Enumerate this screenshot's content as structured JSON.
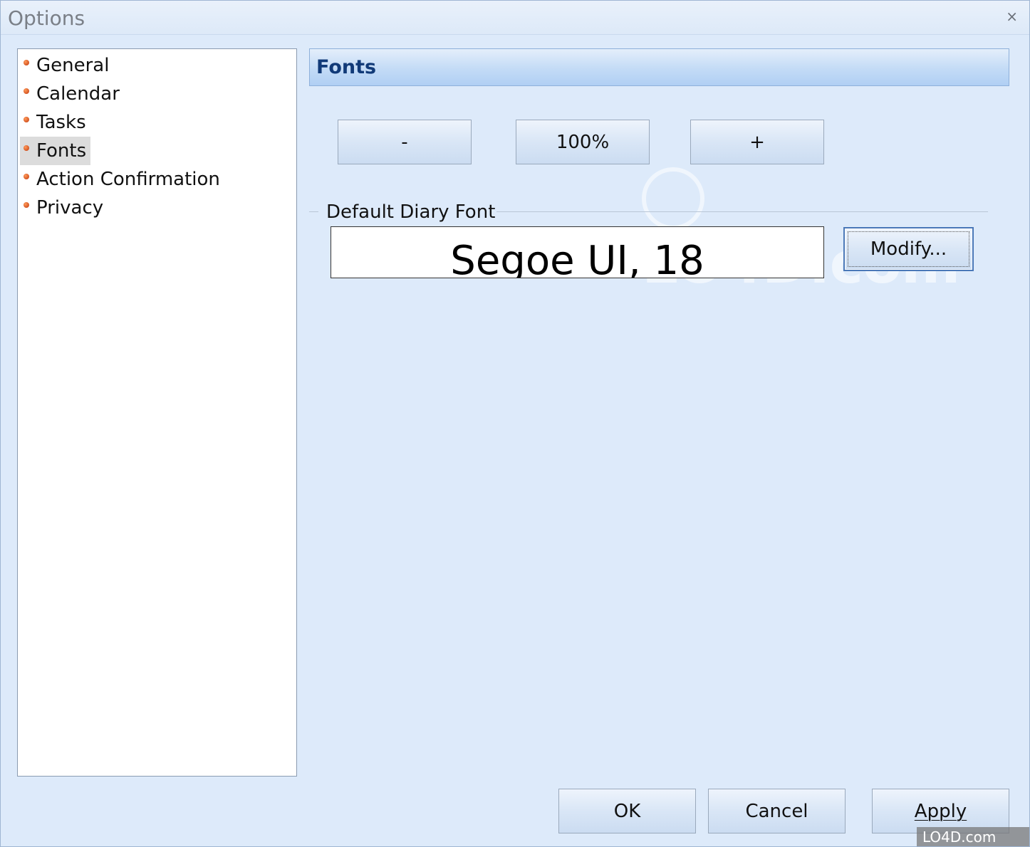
{
  "window": {
    "title": "Options",
    "close_glyph": "×"
  },
  "sidebar": {
    "items": [
      {
        "label": "General",
        "selected": false
      },
      {
        "label": "Calendar",
        "selected": false
      },
      {
        "label": "Tasks",
        "selected": false
      },
      {
        "label": "Fonts",
        "selected": true
      },
      {
        "label": "Action Confirmation",
        "selected": false
      },
      {
        "label": "Privacy",
        "selected": false
      }
    ],
    "bullet_color": "#d84a14"
  },
  "main": {
    "header": "Fonts",
    "zoom": {
      "decrease_label": "-",
      "value_label": "100%",
      "increase_label": "+"
    },
    "default_font": {
      "group_label": "Default Diary Font",
      "preview_text": "Segoe UI, 18",
      "modify_label": "Modify..."
    }
  },
  "footer": {
    "ok_label": "OK",
    "cancel_label": "Cancel",
    "apply_label": "Apply"
  },
  "watermark": {
    "text": "LO4D.com"
  },
  "colors": {
    "window_bg": "#ddeafa",
    "header_text": "#113a78",
    "header_gradient_end": "#b0cff4"
  }
}
